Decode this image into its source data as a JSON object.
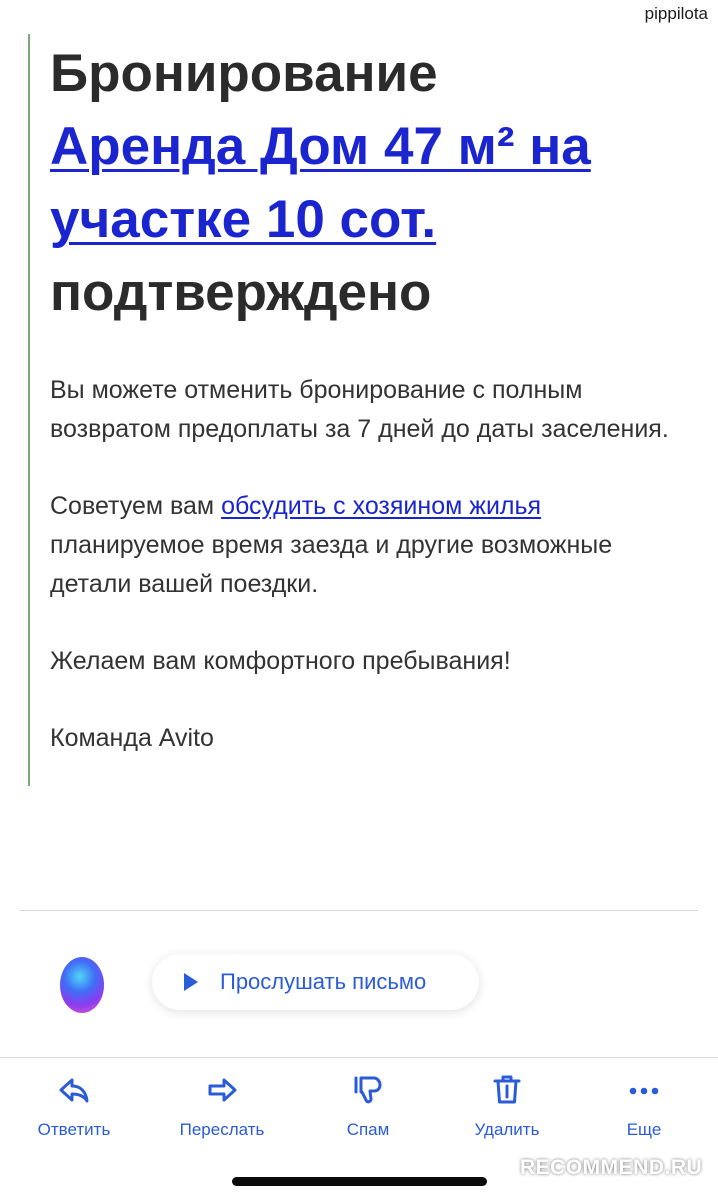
{
  "watermark": {
    "username": "pippilota",
    "site": "RECOMMEND.RU"
  },
  "email": {
    "headline_prefix": "Бронирование",
    "listing_link": "Аренда Дом 47 м² на участке 10 сот.",
    "headline_suffix": "подтверждено",
    "paragraph1": "Вы можете отменить бронирование с полным возвратом предоплаты за 7 дней до даты заселения.",
    "paragraph2_before": "Советуем вам ",
    "paragraph2_link": "обсудить с хозяином жилья",
    "paragraph2_after": " планируемое время заезда и другие возможные детали вашей поездки.",
    "paragraph3": "Желаем вам комфортного пребывания!",
    "signature": "Команда Avito"
  },
  "assistant": {
    "listen_label": "Прослушать письмо"
  },
  "toolbar": {
    "accent_color": "#2a5bd9",
    "items": [
      {
        "label": "Ответить",
        "icon": "reply-icon"
      },
      {
        "label": "Переслать",
        "icon": "forward-icon"
      },
      {
        "label": "Спам",
        "icon": "thumbs-down-icon"
      },
      {
        "label": "Удалить",
        "icon": "trash-icon"
      },
      {
        "label": "Еще",
        "icon": "more-dots-icon"
      }
    ]
  }
}
